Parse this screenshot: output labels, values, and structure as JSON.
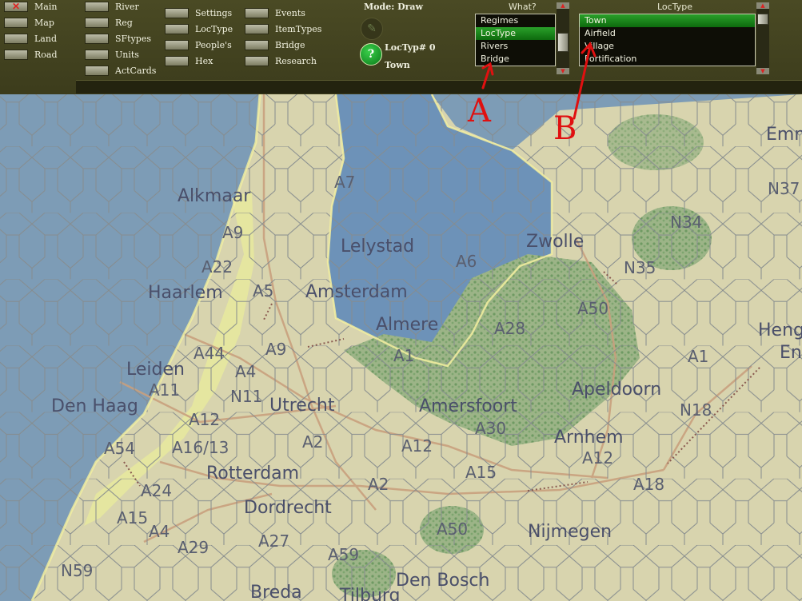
{
  "toolbar": {
    "col1": [
      {
        "label": "Main",
        "icon": "close-x"
      },
      {
        "label": "Map"
      },
      {
        "label": "Land"
      },
      {
        "label": "Road"
      }
    ],
    "col2": [
      {
        "label": "River"
      },
      {
        "label": "Reg"
      },
      {
        "label": "SFtypes"
      },
      {
        "label": "Units"
      },
      {
        "label": "ActCards"
      }
    ],
    "col3": [
      {
        "label": "Settings"
      },
      {
        "label": "LocType"
      },
      {
        "label": "People's"
      },
      {
        "label": "Hex"
      }
    ],
    "col4": [
      {
        "label": "Events"
      },
      {
        "label": "ItemTypes"
      },
      {
        "label": "Bridge"
      },
      {
        "label": "Research"
      }
    ]
  },
  "mode": "Mode: Draw",
  "loctyp_label": "LocTyp# 0",
  "loctyp_name": "Town",
  "help_glyph": "?",
  "what": {
    "header": "What?",
    "items": [
      "Regimes",
      "LocType",
      "Rivers",
      "Bridge"
    ],
    "selected": 1
  },
  "loctype": {
    "header": "LocType",
    "items": [
      "Town",
      "Airfield",
      "Village",
      "Fortification"
    ],
    "selected": 0
  },
  "annotations": {
    "a": "A",
    "b": "B",
    "color": "#e01010"
  },
  "map": {
    "colors": {
      "sea": "#7898b4",
      "lake": "#6e93b8",
      "land": "#d9d6b2",
      "forest": "#9fb78a",
      "road": "#c89a7a",
      "hex": "#8a8f92"
    },
    "cities": [
      {
        "name": "Alkmaar",
        "size": "lg"
      },
      {
        "name": "Lelystad",
        "size": "lg"
      },
      {
        "name": "Zwolle",
        "size": "lg"
      },
      {
        "name": "Haarlem",
        "size": "lg"
      },
      {
        "name": "Amsterdam",
        "size": "lg"
      },
      {
        "name": "Almere",
        "size": "lg"
      },
      {
        "name": "Leiden",
        "size": "lg"
      },
      {
        "name": "Apeldoorn",
        "size": "lg"
      },
      {
        "name": "Den Haag",
        "size": "lg"
      },
      {
        "name": "Utrecht",
        "size": "lg"
      },
      {
        "name": "Amersfoort",
        "size": "lg"
      },
      {
        "name": "Arnhem",
        "size": "lg"
      },
      {
        "name": "Rotterdam",
        "size": "lg"
      },
      {
        "name": "Dordrecht",
        "size": "lg"
      },
      {
        "name": "Nijmegen",
        "size": "lg"
      },
      {
        "name": "Den Bosch",
        "size": "lg"
      },
      {
        "name": "Breda",
        "size": "lg"
      },
      {
        "name": "Tilburg",
        "size": "lg"
      },
      {
        "name": "Emm",
        "size": "lg"
      },
      {
        "name": "Heng",
        "size": "lg"
      },
      {
        "name": "En",
        "size": "lg"
      }
    ],
    "roads": [
      "A7",
      "A9",
      "A22",
      "A5",
      "A6",
      "N34",
      "N35",
      "N37",
      "A50",
      "A28",
      "A44",
      "A9",
      "A4",
      "A1",
      "A1",
      "A11",
      "N11",
      "N18",
      "A12",
      "A30",
      "A2",
      "A12",
      "A54",
      "A16/13",
      "A12",
      "A24",
      "A2",
      "A15",
      "A18",
      "A15",
      "A4",
      "A27",
      "A50",
      "A29",
      "A59",
      "N59"
    ]
  }
}
